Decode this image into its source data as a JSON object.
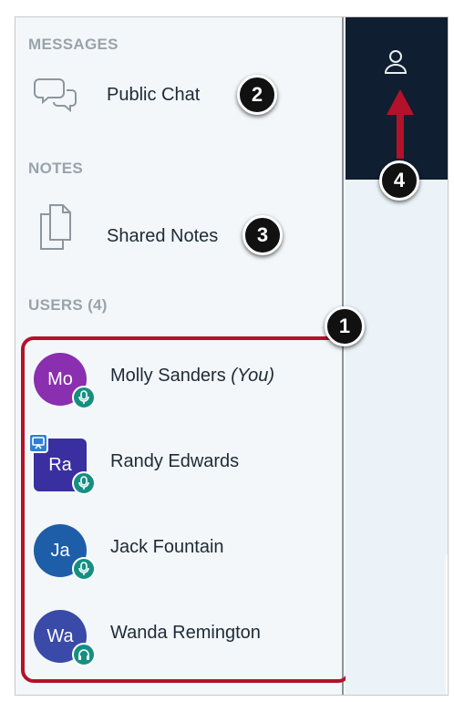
{
  "sidebar": {
    "messages_title": "MESSAGES",
    "public_chat_label": "Public Chat",
    "notes_title": "NOTES",
    "shared_notes_label": "Shared Notes",
    "users_title": "USERS (4)"
  },
  "users": [
    {
      "initials": "Mo",
      "name": "Molly Sanders",
      "suffix": "(You)",
      "color": "#8a2fb0",
      "audio": "mic-icon"
    },
    {
      "initials": "Ra",
      "name": "Randy Edwards",
      "suffix": "",
      "color": "#3a2fa0",
      "audio": "mic-icon",
      "presenter": true
    },
    {
      "initials": "Ja",
      "name": "Jack Fountain",
      "suffix": "",
      "color": "#1e5ea8",
      "audio": "mic-icon"
    },
    {
      "initials": "Wa",
      "name": "Wanda Remington",
      "suffix": "",
      "color": "#3a4aa8",
      "audio": "headphones-icon"
    }
  ],
  "callouts": {
    "one": "1",
    "two": "2",
    "three": "3",
    "four": "4"
  },
  "colors": {
    "highlight": "#b3122a",
    "header": "#0f1e30",
    "status": "#168f82",
    "arrow": "#b3122a"
  }
}
